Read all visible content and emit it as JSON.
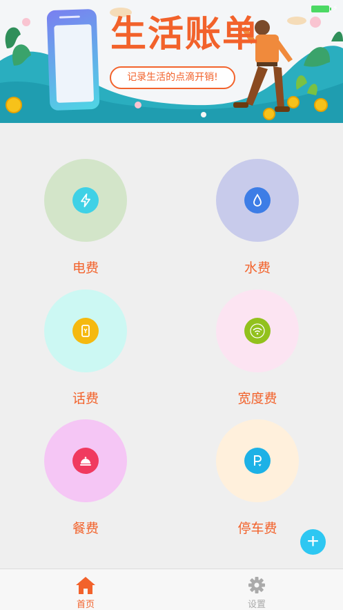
{
  "banner": {
    "title": "生活账单",
    "subtitle": "记录生活的点滴开销!"
  },
  "categories": [
    {
      "label": "电费",
      "icon": "lightning-icon",
      "bg": "#d3e5c9",
      "icon_bg": "#3fd1e6"
    },
    {
      "label": "水费",
      "icon": "water-drop-icon",
      "bg": "#c8cbeb",
      "icon_bg": "#3d7de6"
    },
    {
      "label": "话费",
      "icon": "mobile-phone-icon",
      "bg": "#ccf8f3",
      "icon_bg": "#f5b90f"
    },
    {
      "label": "宽度费",
      "icon": "wifi-icon",
      "bg": "#fce4f2",
      "icon_bg": "#92c11d"
    },
    {
      "label": "餐费",
      "icon": "food-cloche-icon",
      "bg": "#f5c6f5",
      "icon_bg": "#f03a5f"
    },
    {
      "label": "停车费",
      "icon": "parking-icon",
      "bg": "#fff0dc",
      "icon_bg": "#1db1e6"
    }
  ],
  "fab": {
    "icon": "plus-icon"
  },
  "tabs": [
    {
      "label": "首页",
      "icon": "home-icon",
      "active": true
    },
    {
      "label": "设置",
      "icon": "gear-icon",
      "active": false
    }
  ],
  "colors": {
    "accent": "#f2622b",
    "fab": "#2ec7f2",
    "tab_inactive": "#aaaaaa"
  }
}
